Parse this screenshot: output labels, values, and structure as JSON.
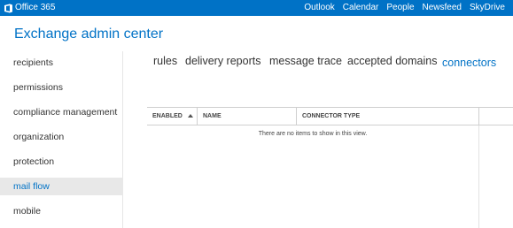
{
  "topbar": {
    "brand": "Office 365",
    "nav": [
      "Outlook",
      "Calendar",
      "People",
      "Newsfeed",
      "SkyDrive"
    ],
    "accent_color": "#0072c6"
  },
  "header": {
    "title": "Exchange admin center"
  },
  "sidebar": {
    "items": [
      {
        "label": "recipients"
      },
      {
        "label": "permissions"
      },
      {
        "label": "compliance management"
      },
      {
        "label": "organization"
      },
      {
        "label": "protection"
      },
      {
        "label": "mail flow",
        "selected": true
      },
      {
        "label": "mobile"
      }
    ]
  },
  "tabs": [
    {
      "label": "rules"
    },
    {
      "label": "delivery reports"
    },
    {
      "label": "message trace"
    },
    {
      "label": "accepted domains"
    },
    {
      "label": "connectors",
      "active": true
    }
  ],
  "table": {
    "columns": [
      "ENABLED",
      "NAME",
      "CONNECTOR TYPE"
    ],
    "sort_icon": "sort-ascending-icon",
    "empty_message": "There are no items to show in this view."
  }
}
